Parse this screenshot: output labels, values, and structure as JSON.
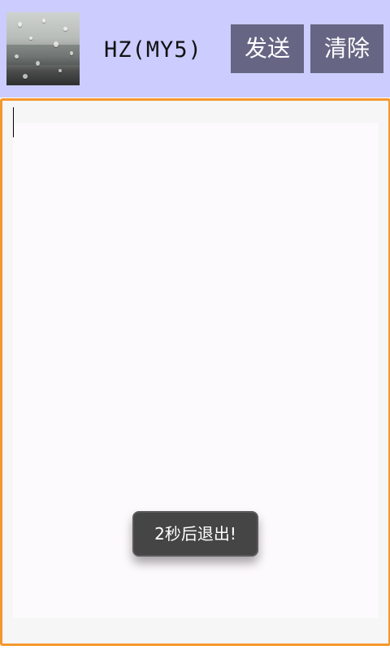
{
  "header": {
    "title": "HZ(MY5)",
    "send_label": "发送",
    "clear_label": "清除"
  },
  "editor": {
    "value": ""
  },
  "toast": {
    "message": "2秒后退出!"
  },
  "colors": {
    "header_bg": "#ccccff",
    "button_bg": "#666684",
    "editor_focus_border": "#f5972e",
    "toast_bg": "#454545"
  }
}
